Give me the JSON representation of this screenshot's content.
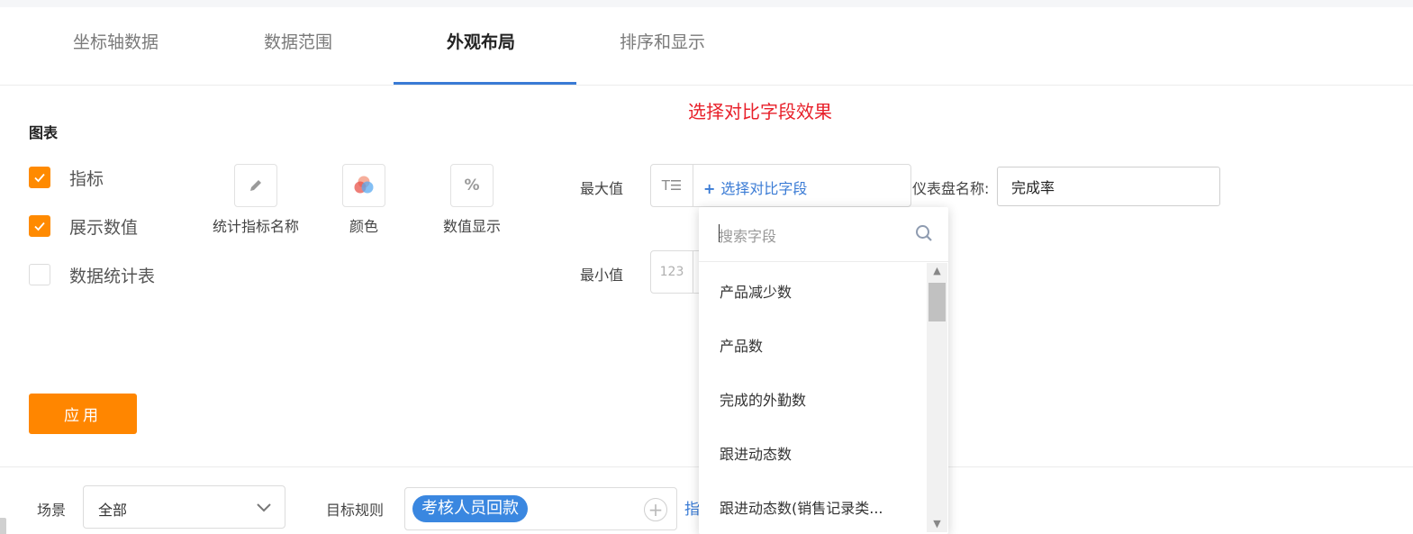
{
  "tabs": [
    {
      "label": "坐标轴数据"
    },
    {
      "label": "数据范围"
    },
    {
      "label": "外观布局"
    },
    {
      "label": "排序和显示"
    }
  ],
  "active_tab": "外观布局",
  "annotation": "选择对比字段效果",
  "chart_section": {
    "title": "图表",
    "checks": [
      {
        "label": "指标",
        "checked": true
      },
      {
        "label": "展示数值",
        "checked": true
      },
      {
        "label": "数据统计表",
        "checked": false
      }
    ],
    "tools": [
      {
        "label": "统计指标名称",
        "icon": "pencil-icon"
      },
      {
        "label": "颜色",
        "icon": "color-palette-icon"
      },
      {
        "label": "数值显示",
        "icon": "percent-icon"
      }
    ]
  },
  "fields": {
    "max_label": "最大值",
    "min_label": "最小值",
    "max_type_icon": "T☰",
    "min_type_icon": "123",
    "add_field_label": "选择对比字段",
    "gauge_name_label": "仪表盘名称:",
    "gauge_name_value": "完成率"
  },
  "dropdown": {
    "search_placeholder": "搜索字段",
    "items": [
      "产品减少数",
      "产品数",
      "完成的外勤数",
      "跟进动态数",
      "跟进动态数(销售记录类..."
    ]
  },
  "apply_label": "应用",
  "bottom": {
    "scene_label": "场景",
    "scene_value": "全部",
    "rule_label": "目标规则",
    "rule_tag": "考核人员回款",
    "link_fragment": "指"
  },
  "colors": {
    "accent_orange": "#ff8600",
    "accent_blue": "#3a7bd5",
    "annotation_red": "#e8202a"
  }
}
